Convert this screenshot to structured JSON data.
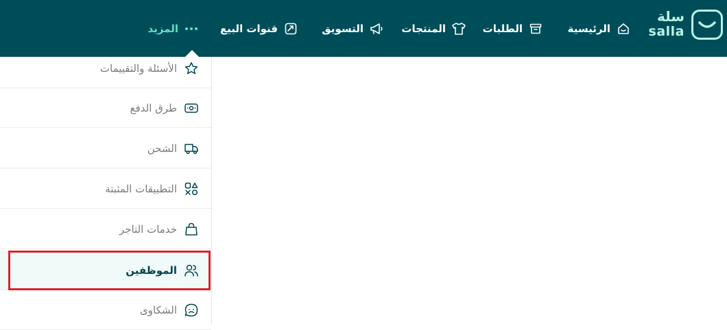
{
  "brand": {
    "name_ar": "سلة",
    "name_en": "salla"
  },
  "nav": {
    "home": "الرئيسية",
    "orders": "الطلبات",
    "products": "المنتجات",
    "marketing": "التسويق",
    "sales_channels": "قنوات البيع",
    "more": "المزيد"
  },
  "dropdown": {
    "items": [
      {
        "label": "الأسئلة والتقييمات",
        "icon": "star-icon"
      },
      {
        "label": "طرق الدفع",
        "icon": "payment-icon"
      },
      {
        "label": "الشحن",
        "icon": "truck-icon"
      },
      {
        "label": "التطبيقات المثبتة",
        "icon": "apps-icon"
      },
      {
        "label": "خدمات التاجر",
        "icon": "shopping-bag-icon"
      },
      {
        "label": "الموظفين",
        "icon": "users-icon"
      },
      {
        "label": "الشكاوى",
        "icon": "complaint-icon"
      }
    ]
  },
  "colors": {
    "header": "#004d5a",
    "accent": "#5fe0c3",
    "highlight": "#e0212b"
  }
}
